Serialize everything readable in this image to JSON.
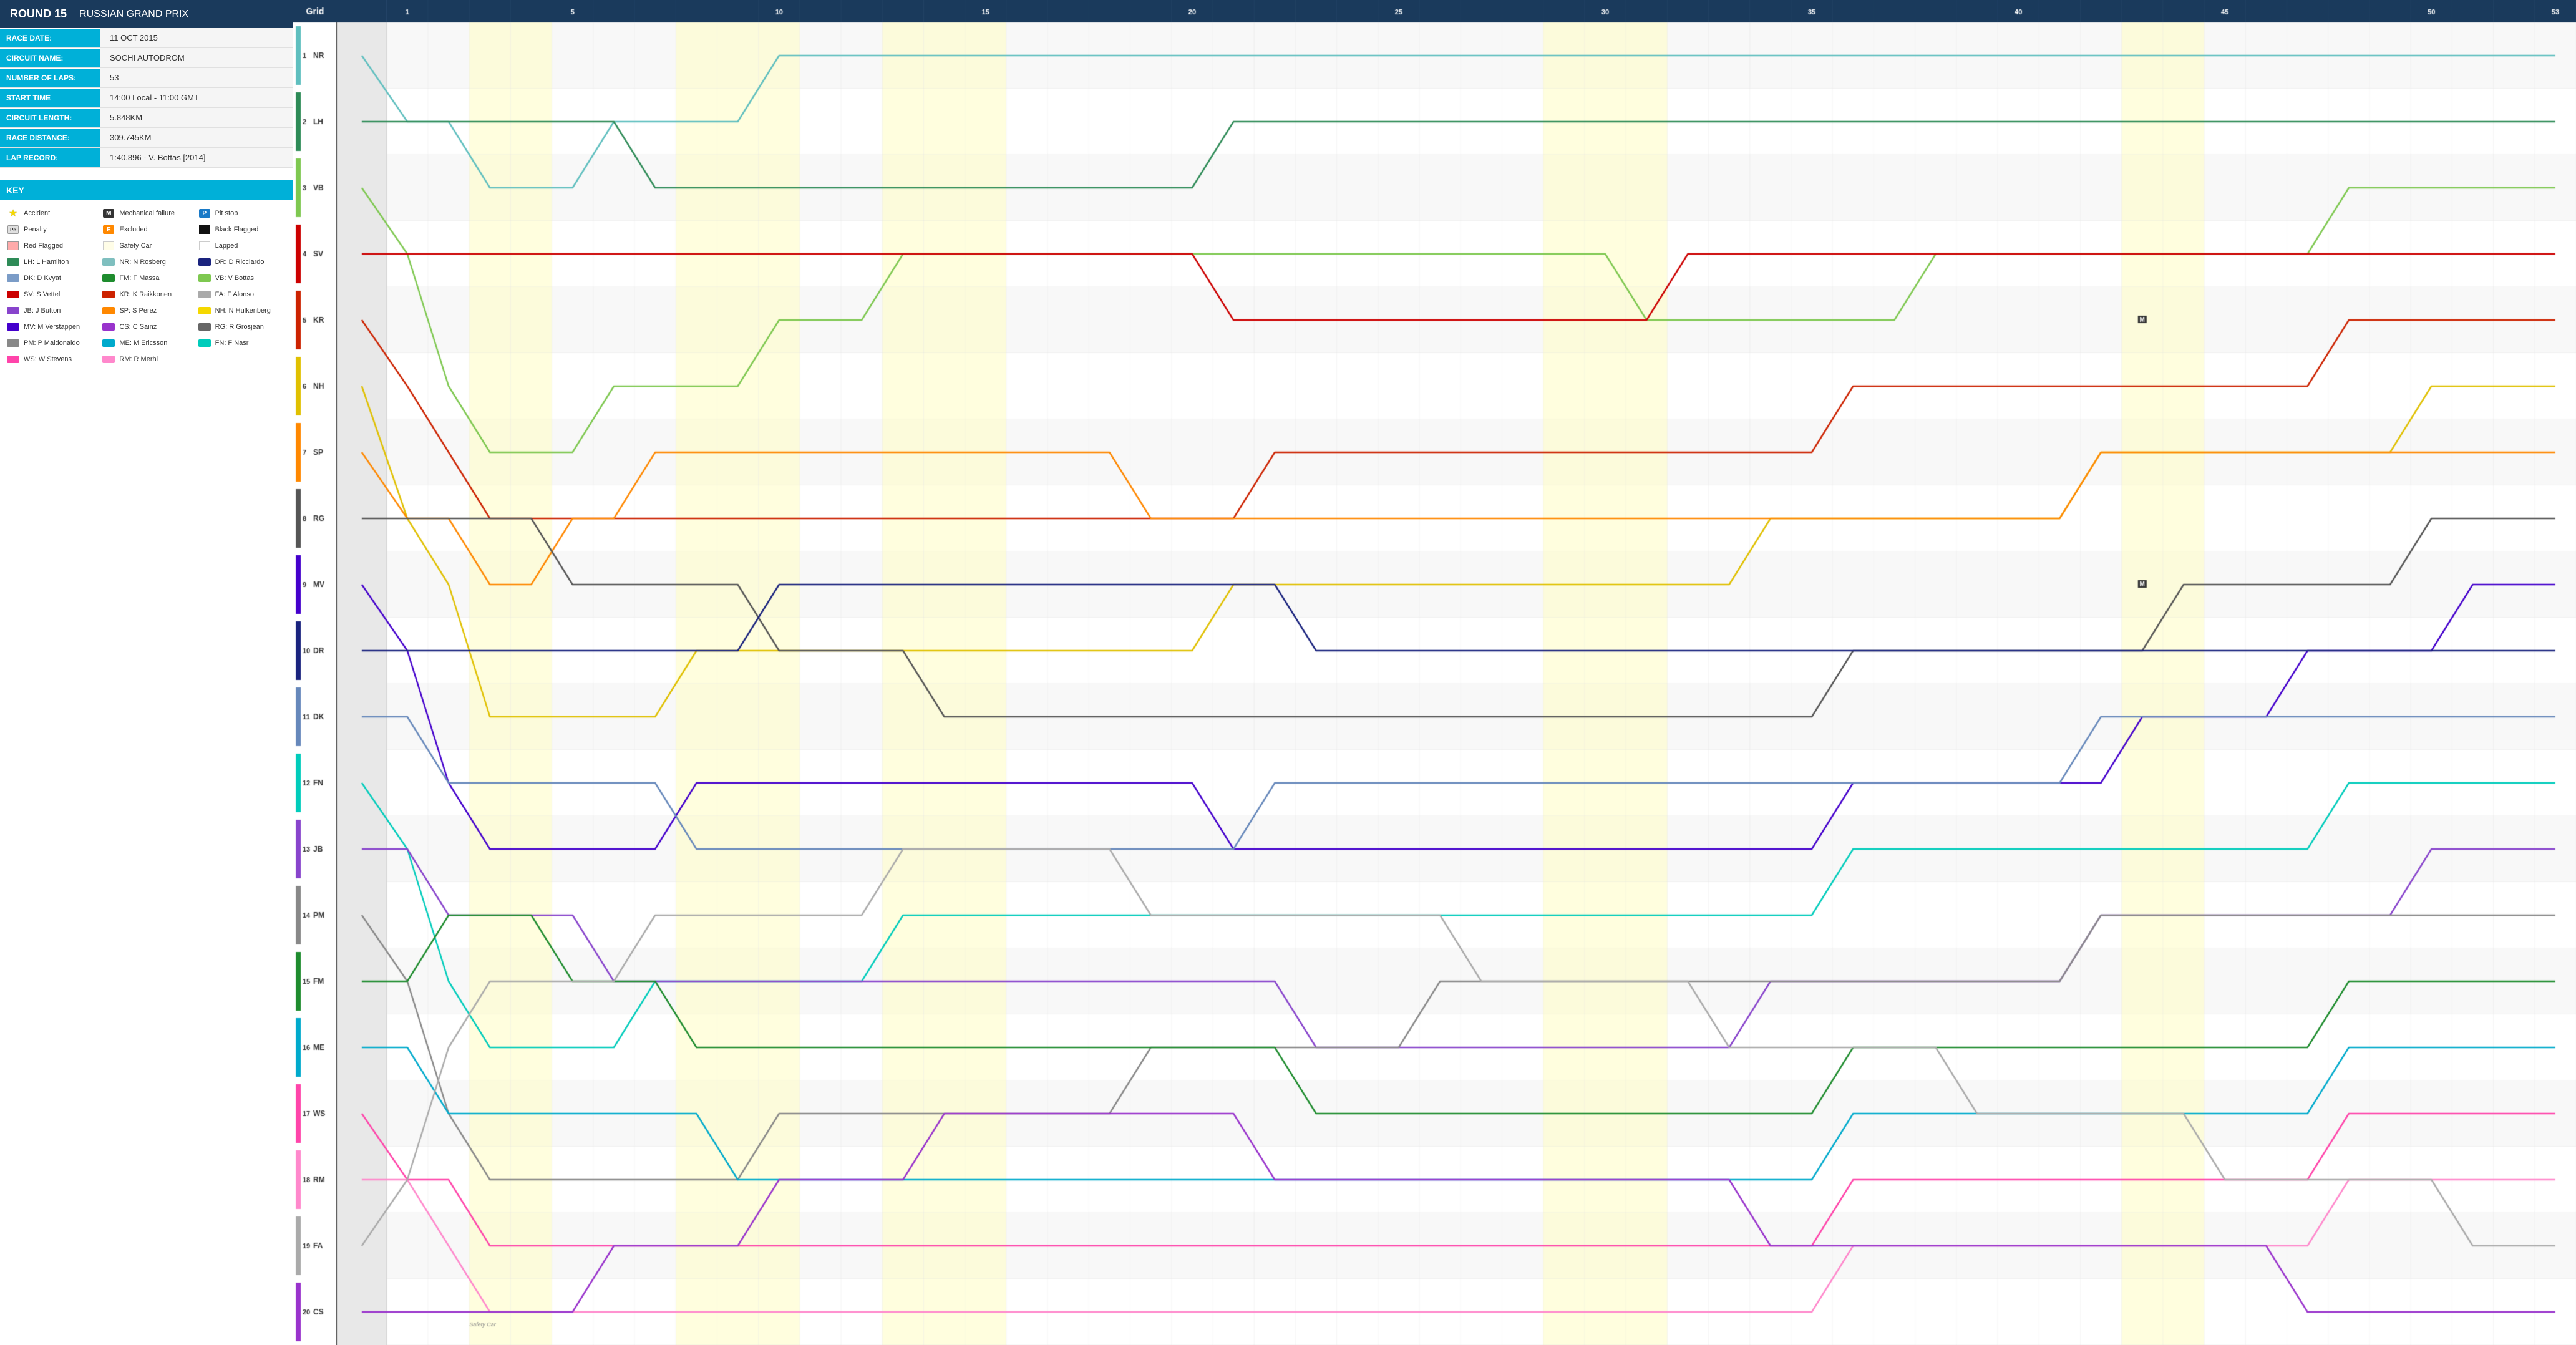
{
  "left": {
    "round_label": "ROUND 15",
    "race_name": "RUSSIAN GRAND PRIX",
    "fields": [
      {
        "label": "RACE DATE:",
        "value": "11 OCT 2015"
      },
      {
        "label": "CIRCUIT NAME:",
        "value": "SOCHI AUTODROM"
      },
      {
        "label": "NUMBER OF LAPS:",
        "value": "53"
      },
      {
        "label": "START TIME",
        "value": "14:00 Local - 11:00 GMT"
      },
      {
        "label": "CIRCUIT LENGTH:",
        "value": "5.848KM"
      },
      {
        "label": "RACE DISTANCE:",
        "value": "309.745KM"
      },
      {
        "label": "LAP RECORD:",
        "value": "1:40.896 - V. Bottas [2014]"
      }
    ],
    "key_title": "KEY",
    "key_items": [
      {
        "type": "star",
        "label": "Accident"
      },
      {
        "type": "M",
        "label": "Mechanical failure"
      },
      {
        "type": "P",
        "label": "Pit stop"
      },
      {
        "type": "Pe",
        "label": "Penalty"
      },
      {
        "type": "E",
        "label": "Excluded"
      },
      {
        "type": "black",
        "label": "Black Flagged"
      },
      {
        "type": "redflag",
        "label": "Red Flagged"
      },
      {
        "type": "safety",
        "label": "Safety Car"
      },
      {
        "type": "lapped",
        "label": "Lapped"
      },
      {
        "type": "color",
        "color": "#2e8b57",
        "label": "LH: L Hamilton"
      },
      {
        "type": "color",
        "color": "#7fbfbf",
        "label": "NR: N Rosberg"
      },
      {
        "type": "color",
        "color": "#1a237e",
        "label": "DR: D Ricciardo"
      },
      {
        "type": "color",
        "color": "#7b9cc7",
        "label": "DK: D Kvyat"
      },
      {
        "type": "color",
        "color": "#1e8c2e",
        "label": "FM: F Massa"
      },
      {
        "type": "color",
        "color": "#7ec850",
        "label": "VB: V Bottas"
      },
      {
        "type": "color",
        "color": "#cc0000",
        "label": "SV: S Vettel"
      },
      {
        "type": "color",
        "color": "#cc2200",
        "label": "KR: K Raikkonen"
      },
      {
        "type": "color",
        "color": "#aaaaaa",
        "label": "FA: F Alonso"
      },
      {
        "type": "color",
        "color": "#8844cc",
        "label": "JB: J Button"
      },
      {
        "type": "color",
        "color": "#ff8800",
        "label": "SP: S Perez"
      },
      {
        "type": "color",
        "color": "#f5d800",
        "label": "NH: N Hulkenberg"
      },
      {
        "type": "color",
        "color": "#4400cc",
        "label": "MV: M Verstappen"
      },
      {
        "type": "color",
        "color": "#9933cc",
        "label": "CS: C Sainz"
      },
      {
        "type": "color",
        "color": "#666666",
        "label": "RG: R Grosjean"
      },
      {
        "type": "color",
        "color": "#888888",
        "label": "PM: P Maldonaldo"
      },
      {
        "type": "color",
        "color": "#00aacc",
        "label": "ME: M Ericsson"
      },
      {
        "type": "color",
        "color": "#00ccbb",
        "label": "FN: F Nasr"
      },
      {
        "type": "color",
        "color": "#ff44aa",
        "label": "WS: W Stevens"
      },
      {
        "type": "color",
        "color": "#ff88cc",
        "label": "RM: R Merhi"
      }
    ]
  },
  "chart": {
    "grid_label": "Grid",
    "total_laps": 53,
    "drivers": [
      {
        "pos": 1,
        "code": "NR",
        "color": "#5fbfbf"
      },
      {
        "pos": 2,
        "code": "LH",
        "color": "#2e8b57"
      },
      {
        "pos": 3,
        "code": "VB",
        "color": "#7ec850"
      },
      {
        "pos": 4,
        "code": "SV",
        "color": "#cc0000"
      },
      {
        "pos": 5,
        "code": "KR",
        "color": "#cc2200"
      },
      {
        "pos": 6,
        "code": "NH",
        "color": "#e0c000"
      },
      {
        "pos": 7,
        "code": "SP",
        "color": "#ff8800"
      },
      {
        "pos": 8,
        "code": "RG",
        "color": "#555555"
      },
      {
        "pos": 9,
        "code": "MV",
        "color": "#4400cc"
      },
      {
        "pos": 10,
        "code": "DR",
        "color": "#1a237e"
      },
      {
        "pos": 11,
        "code": "DK",
        "color": "#6688bb"
      },
      {
        "pos": 12,
        "code": "FN",
        "color": "#00ccbb"
      },
      {
        "pos": 13,
        "code": "JB",
        "color": "#8844cc"
      },
      {
        "pos": 14,
        "code": "PM",
        "color": "#888888"
      },
      {
        "pos": 15,
        "code": "FM",
        "color": "#1e8c2e"
      },
      {
        "pos": 16,
        "code": "ME",
        "color": "#00aacc"
      },
      {
        "pos": 17,
        "code": "WS",
        "color": "#ff44aa"
      },
      {
        "pos": 18,
        "code": "RM",
        "color": "#ff88cc"
      },
      {
        "pos": 19,
        "code": "FA",
        "color": "#aaaaaa"
      },
      {
        "pos": 20,
        "code": "CS",
        "color": "#9933cc"
      }
    ],
    "safety_car_laps": [
      3,
      4,
      8,
      9,
      10,
      13,
      14,
      15,
      29,
      30,
      31,
      43,
      44
    ]
  }
}
